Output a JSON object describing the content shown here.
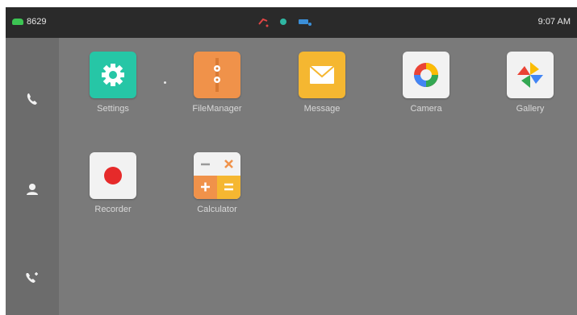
{
  "status_bar": {
    "account": "8629",
    "time": "9:07 AM"
  },
  "sidebar": {
    "items": [
      {
        "icon": "phone-icon"
      },
      {
        "icon": "contacts-icon"
      },
      {
        "icon": "call-history-icon"
      }
    ]
  },
  "apps": [
    {
      "label": "Settings",
      "icon": "settings-gear-icon",
      "color": "#26c6a6"
    },
    {
      "label": "FileManager",
      "icon": "file-manager-icon",
      "color": "#f0924a"
    },
    {
      "label": "Message",
      "icon": "envelope-icon",
      "color": "#f5b731"
    },
    {
      "label": "Camera",
      "icon": "camera-lens-icon",
      "color": "#f2f2f2"
    },
    {
      "label": "Gallery",
      "icon": "pinwheel-icon",
      "color": "#f2f2f2"
    },
    {
      "label": "Recorder",
      "icon": "record-icon",
      "color": "#f2f2f2"
    },
    {
      "label": "Calculator",
      "icon": "calculator-icon",
      "color": "#f0924a"
    }
  ],
  "colors": {
    "status_bar_bg": "#2a2a2a",
    "screen_bg": "#7a7a7a",
    "sidebar_bg": "#6c6c6c",
    "line_green": "#3cc453"
  }
}
